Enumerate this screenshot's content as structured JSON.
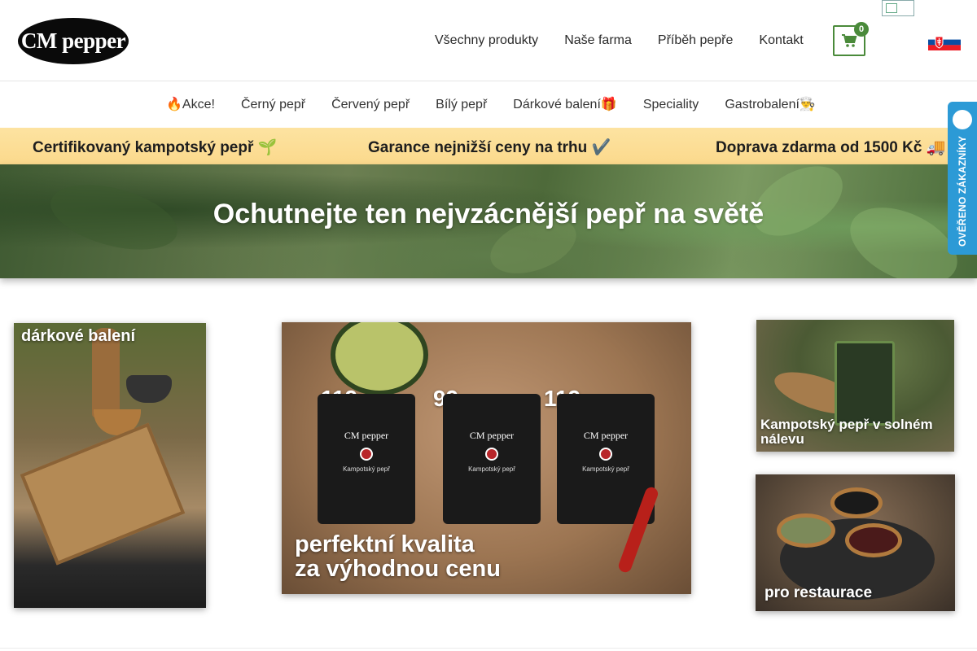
{
  "header": {
    "logo_text": "CM pepper",
    "nav": [
      "Všechny produkty",
      "Naše farma",
      "Příběh pepře",
      "Kontakt"
    ],
    "cart_count": "0",
    "cart_icon": "cart-icon",
    "language_flag": "slovak-flag-icon"
  },
  "categories": [
    "🔥Akce!",
    "Černý pepř",
    "Červený pepř",
    "Bílý pepř",
    "Dárkové balení🎁",
    "Speciality",
    "Gastrobalení👨‍🍳"
  ],
  "benefits": [
    "Certifikovaný kampotský pepř 🌱",
    "Garance nejnižší ceny na trhu ✔️",
    "Doprava zdarma od 1500 Kč 🚚"
  ],
  "hero": {
    "title": "Ochutnejte ten nejvzácnější pepř na světě"
  },
  "verified_tab": {
    "label": "OVĚŘENO ZÁKAZNÍKY"
  },
  "tiles": {
    "gift": {
      "label": "dárkové balení"
    },
    "price": {
      "prices": [
        "119,-",
        "99,-",
        "119,-"
      ],
      "bag_logo": "CM pepper",
      "bag_name": "Kampotský pepř",
      "label_line1": "perfektní kvalita",
      "label_line2": "za výhodnou cenu"
    },
    "brine": {
      "label": "Kampotský pepř v solném nálevu"
    },
    "restaurant": {
      "label": "pro restaurace"
    }
  },
  "colors": {
    "accent_green": "#4a8a3a",
    "benefit_bar": "#fbd98c",
    "verified_blue": "#2c9ad6"
  }
}
